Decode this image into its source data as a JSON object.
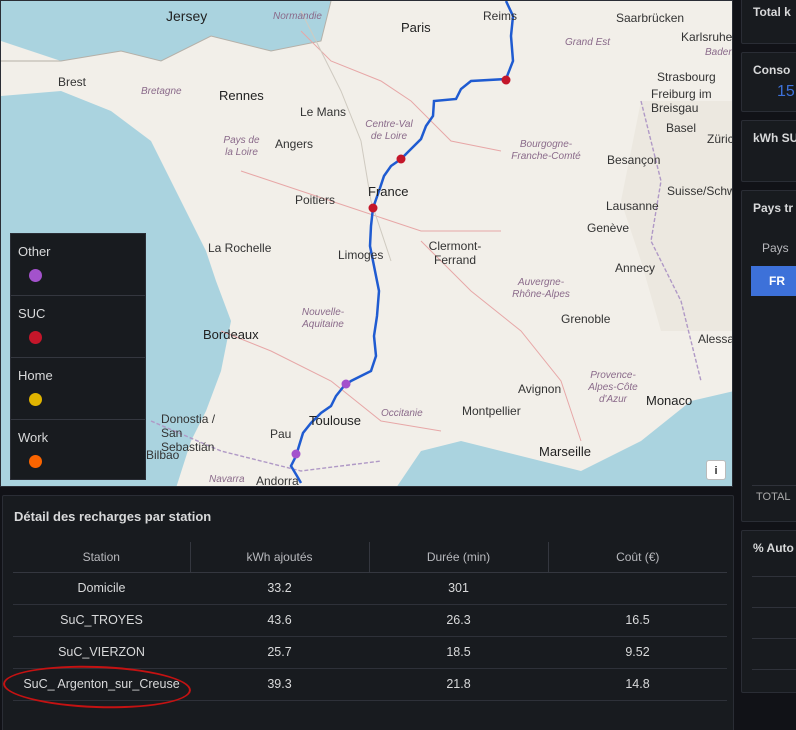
{
  "map": {
    "cities": [
      {
        "name": "Jersey",
        "cls": "city"
      },
      {
        "name": "Normandie",
        "cls": "region"
      },
      {
        "name": "Paris",
        "cls": "city big"
      },
      {
        "name": "Reims",
        "cls": "city"
      },
      {
        "name": "Saarbrücken",
        "cls": "city"
      },
      {
        "name": "Karlsruhe",
        "cls": "city"
      },
      {
        "name": "Brest",
        "cls": "city"
      },
      {
        "name": "Bretagne",
        "cls": "region"
      },
      {
        "name": "Rennes",
        "cls": "city big"
      },
      {
        "name": "Le Mans",
        "cls": "city"
      },
      {
        "name": "Grand Est",
        "cls": "region"
      },
      {
        "name": "Strasbourg",
        "cls": "city"
      },
      {
        "name": "Baden",
        "cls": "region"
      },
      {
        "name": "Freiburg im Breisgau",
        "cls": "city"
      },
      {
        "name": "Centre-Val de Loire",
        "cls": "region"
      },
      {
        "name": "Angers",
        "cls": "city"
      },
      {
        "name": "Pays de la Loire",
        "cls": "region"
      },
      {
        "name": "Bourgogne-Franche-Comté",
        "cls": "region"
      },
      {
        "name": "Besançon",
        "cls": "city"
      },
      {
        "name": "Basel",
        "cls": "city"
      },
      {
        "name": "Zürich",
        "cls": "city"
      },
      {
        "name": "France",
        "cls": "city big"
      },
      {
        "name": "Poitiers",
        "cls": "city"
      },
      {
        "name": "Lausanne",
        "cls": "city"
      },
      {
        "name": "Suisse/Schweiz",
        "cls": "city"
      },
      {
        "name": "Genève",
        "cls": "city"
      },
      {
        "name": "La Rochelle",
        "cls": "city"
      },
      {
        "name": "Limoges",
        "cls": "city"
      },
      {
        "name": "Clermont-Ferrand",
        "cls": "city"
      },
      {
        "name": "Annecy",
        "cls": "city"
      },
      {
        "name": "Auvergne-Rhône-Alpes",
        "cls": "region"
      },
      {
        "name": "Nouvelle-Aquitaine",
        "cls": "region"
      },
      {
        "name": "Bordeaux",
        "cls": "city big"
      },
      {
        "name": "Grenoble",
        "cls": "city"
      },
      {
        "name": "Alessa",
        "cls": "city"
      },
      {
        "name": "Avignon",
        "cls": "city"
      },
      {
        "name": "Provence-Alpes-Côte d'Azur",
        "cls": "region"
      },
      {
        "name": "Monaco",
        "cls": "city big"
      },
      {
        "name": "Toulouse",
        "cls": "city big"
      },
      {
        "name": "Occitanie",
        "cls": "region"
      },
      {
        "name": "Montpellier",
        "cls": "city"
      },
      {
        "name": "Donostia / San Sebastián",
        "cls": "city"
      },
      {
        "name": "Pau",
        "cls": "city"
      },
      {
        "name": "Bilbao",
        "cls": "city"
      },
      {
        "name": "Marseille",
        "cls": "city big"
      },
      {
        "name": "Navarra",
        "cls": "region"
      },
      {
        "name": "Andorra",
        "cls": "city"
      }
    ],
    "info_label": "i",
    "route_color": "#1f5bd1",
    "markers": [
      {
        "type": "SUC",
        "color": "#c4162a"
      },
      {
        "type": "SUC",
        "color": "#c4162a"
      },
      {
        "type": "SUC",
        "color": "#c4162a"
      },
      {
        "type": "Other",
        "color": "#a352cc"
      },
      {
        "type": "Other",
        "color": "#a352cc"
      }
    ]
  },
  "legend": [
    {
      "label": "Other",
      "color": "#a352cc"
    },
    {
      "label": "SUC",
      "color": "#c4162a"
    },
    {
      "label": "Home",
      "color": "#e0b400"
    },
    {
      "label": "Work",
      "color": "#fa6400"
    }
  ],
  "right_panels": {
    "total_title": "Total k",
    "conso_title": "Conso",
    "conso_value": "15",
    "kwh_suc_title": "kWh SU",
    "pays_title": "Pays tr",
    "pays_col": "Pays",
    "pays_value": "FR",
    "total_label": "TOTAL",
    "auto_title": "% Auto"
  },
  "table": {
    "title": "Détail des recharges par station",
    "headers": [
      "Station",
      "kWh ajoutés",
      "Durée (min)",
      "Coût (€)"
    ],
    "rows": [
      [
        "Domicile",
        "33.2",
        "301",
        ""
      ],
      [
        "SuC_TROYES",
        "43.6",
        "26.3",
        "16.5"
      ],
      [
        "SuC_VIERZON",
        "25.7",
        "18.5",
        "9.52"
      ],
      [
        "SuC_ Argenton_sur_Creuse",
        "39.3",
        "21.8",
        "14.8"
      ]
    ]
  }
}
